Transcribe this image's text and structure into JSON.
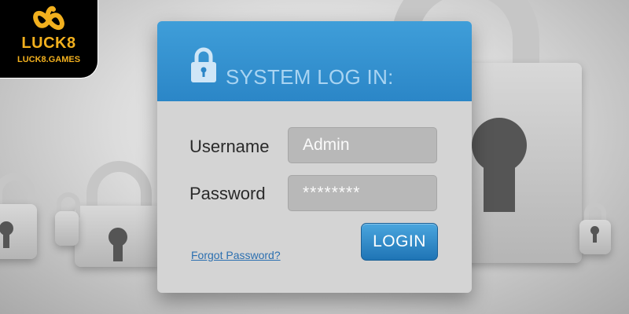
{
  "brand": {
    "name": "LUCK8",
    "domain": "LUCK8.GAMES",
    "accent_color": "#f2b01e"
  },
  "login_panel": {
    "title": "SYSTEM LOG IN:",
    "header_icon": "padlock-icon",
    "header_color": "#2b86c7",
    "username_label": "Username",
    "username_value": "Admin",
    "password_label": "Password",
    "password_value": "********",
    "forgot_link": "Forgot Password?",
    "login_button": "LOGIN"
  },
  "background": {
    "decoration_icon": "padlock-icon"
  }
}
